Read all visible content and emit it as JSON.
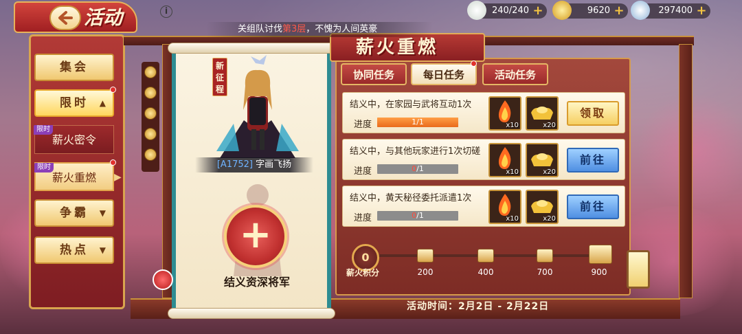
{
  "header": {
    "title": "活动",
    "info_icon": "i",
    "ticker_before": "关组队讨伐",
    "ticker_highlight": "第3层",
    "ticker_after": "，不愧为人间英豪"
  },
  "resources": [
    {
      "icon": "dumpling-icon",
      "value": "240/240"
    },
    {
      "icon": "gold-ingot-icon",
      "value": "9620"
    },
    {
      "icon": "silver-coin-icon",
      "value": "297400"
    }
  ],
  "nav": {
    "gathering": "集会",
    "limited": "限时",
    "limited_tag": "限时",
    "sub_items": [
      "薪火密令",
      "薪火重燃"
    ],
    "contest": "争霸",
    "hot": "热点"
  },
  "hero": {
    "badge": "新征程",
    "code": "[A1752]",
    "name": "字画飞扬",
    "slot_label": "结义资深将军",
    "add_symbol": "+"
  },
  "panel": {
    "title": "薪火重燃",
    "tabs": [
      "协同任务",
      "每日任务",
      "活动任务"
    ],
    "active_tab": 1
  },
  "tasks": [
    {
      "text": "结义中，在家园与武将互动1次",
      "progress_label": "进度",
      "current": "1",
      "total": "/1",
      "progress": 1.0,
      "rewards": [
        {
          "icon": "fire-icon",
          "qty": "x10"
        },
        {
          "icon": "gold-ingot-icon",
          "qty": "x20"
        }
      ],
      "button": "领取",
      "button_type": "claim"
    },
    {
      "text": "结义中，与其他玩家进行1次切磋",
      "progress_label": "进度",
      "current": "0",
      "total": "/1",
      "progress": 0.0,
      "rewards": [
        {
          "icon": "fire-icon",
          "qty": "x10"
        },
        {
          "icon": "gold-ingot-icon",
          "qty": "x20"
        }
      ],
      "button": "前往",
      "button_type": "go"
    },
    {
      "text": "结义中，黄天秘径委托派遣1次",
      "progress_label": "进度",
      "current": "0",
      "total": "/1",
      "progress": 0.0,
      "rewards": [
        {
          "icon": "fire-icon",
          "qty": "x10"
        },
        {
          "icon": "gold-ingot-icon",
          "qty": "x20"
        }
      ],
      "button": "前往",
      "button_type": "go"
    }
  ],
  "points": {
    "current": "0",
    "label": "薪火积分",
    "milestones": [
      "200",
      "400",
      "700",
      "900"
    ]
  },
  "event_time": "活动时间：2月2日 - 2月22日"
}
